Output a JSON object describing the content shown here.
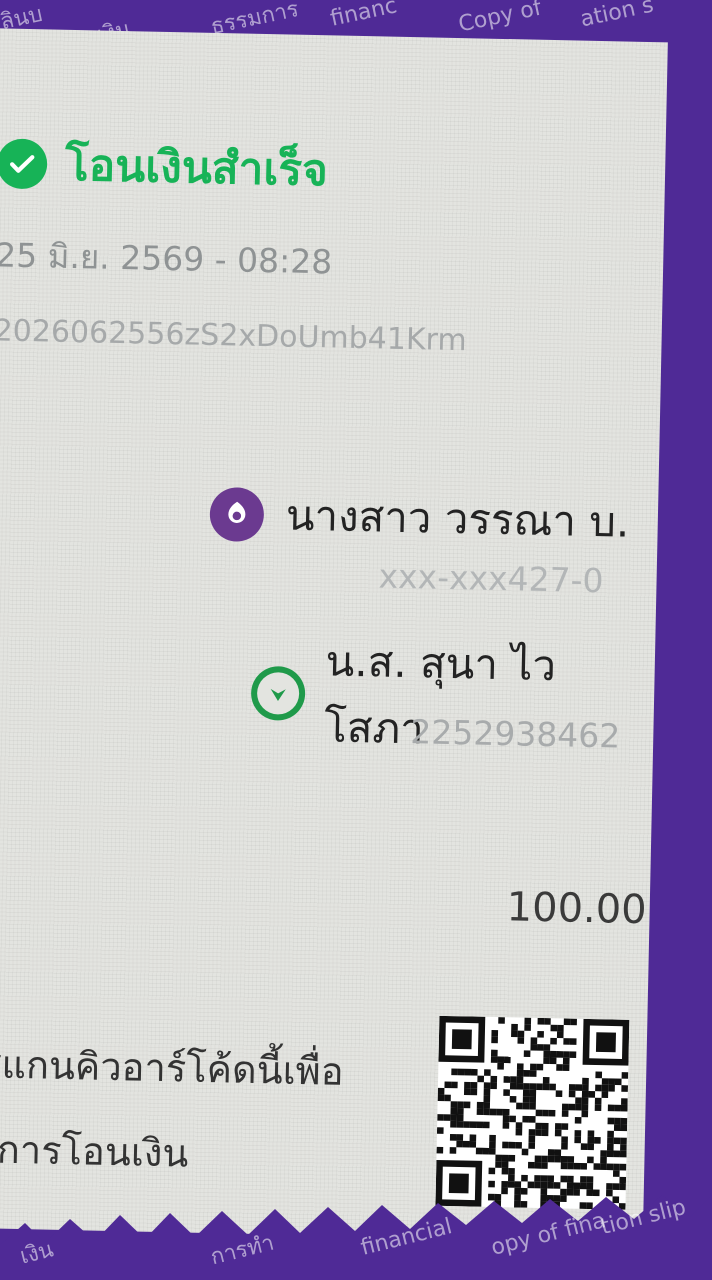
{
  "watermark": {
    "top": [
      "ลินบ",
      "การเงิน",
      "ธรรมการ",
      "financ",
      "Copy of",
      "ation s"
    ],
    "bottom": [
      "เงิน",
      "การทำ",
      "financial",
      "opy of fina",
      "tion slip"
    ]
  },
  "slip": {
    "status": "โอนเงินสำเร็จ",
    "datetime": "25 มิ.ย. 2569 - 08:28",
    "reference": "2026062556zS2xDoUmb41Krm",
    "sender": {
      "name": "นางสาว วรรณา บ.",
      "account": "xxx-xxx427-0"
    },
    "recipient": {
      "name": "น.ส. สุนา ไวโสภา",
      "account": "2252938462"
    },
    "amount": "100.00",
    "scan_line1": "สแกนคิวอาร์โค้ดนี้เพื่อ",
    "scan_line2": "ะการโอนเงิน"
  },
  "colors": {
    "success": "#17b357",
    "frame": "#4f2a96",
    "bank": "#6b3a90",
    "recipient_bank": "#1f9a4a"
  },
  "icons": {
    "status": "check-circle-icon",
    "sender": "bank-logo-icon",
    "recipient": "bank-logo-icon",
    "qr": "qr-code-icon"
  }
}
